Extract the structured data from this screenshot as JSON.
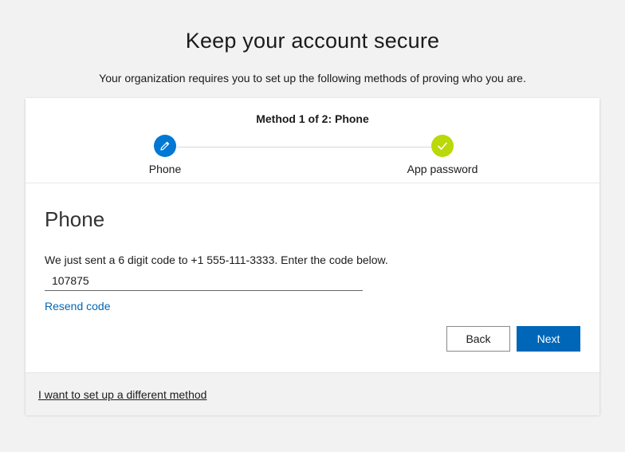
{
  "header": {
    "title": "Keep your account secure",
    "subtitle": "Your organization requires you to set up the following methods of proving who you are."
  },
  "stepper": {
    "heading": "Method 1 of 2: Phone",
    "steps": [
      {
        "label": "Phone",
        "icon": "pencil-icon",
        "color": "#0078d4",
        "state": "current"
      },
      {
        "label": "App password",
        "icon": "check-icon",
        "color": "#bad80a",
        "state": "pending"
      }
    ]
  },
  "phone": {
    "title": "Phone",
    "instruction": "We just sent a 6 digit code to +1 555-111-3333.  Enter the code below.",
    "code_value": "107875",
    "resend_label": "Resend code"
  },
  "actions": {
    "back_label": "Back",
    "next_label": "Next"
  },
  "footer": {
    "different_method_label": "I want to set up a different method"
  },
  "colors": {
    "accent": "#0067b8",
    "link": "#0067b8",
    "step_current": "#0078d4",
    "step_pending": "#bad80a",
    "background": "#f2f2f2"
  }
}
